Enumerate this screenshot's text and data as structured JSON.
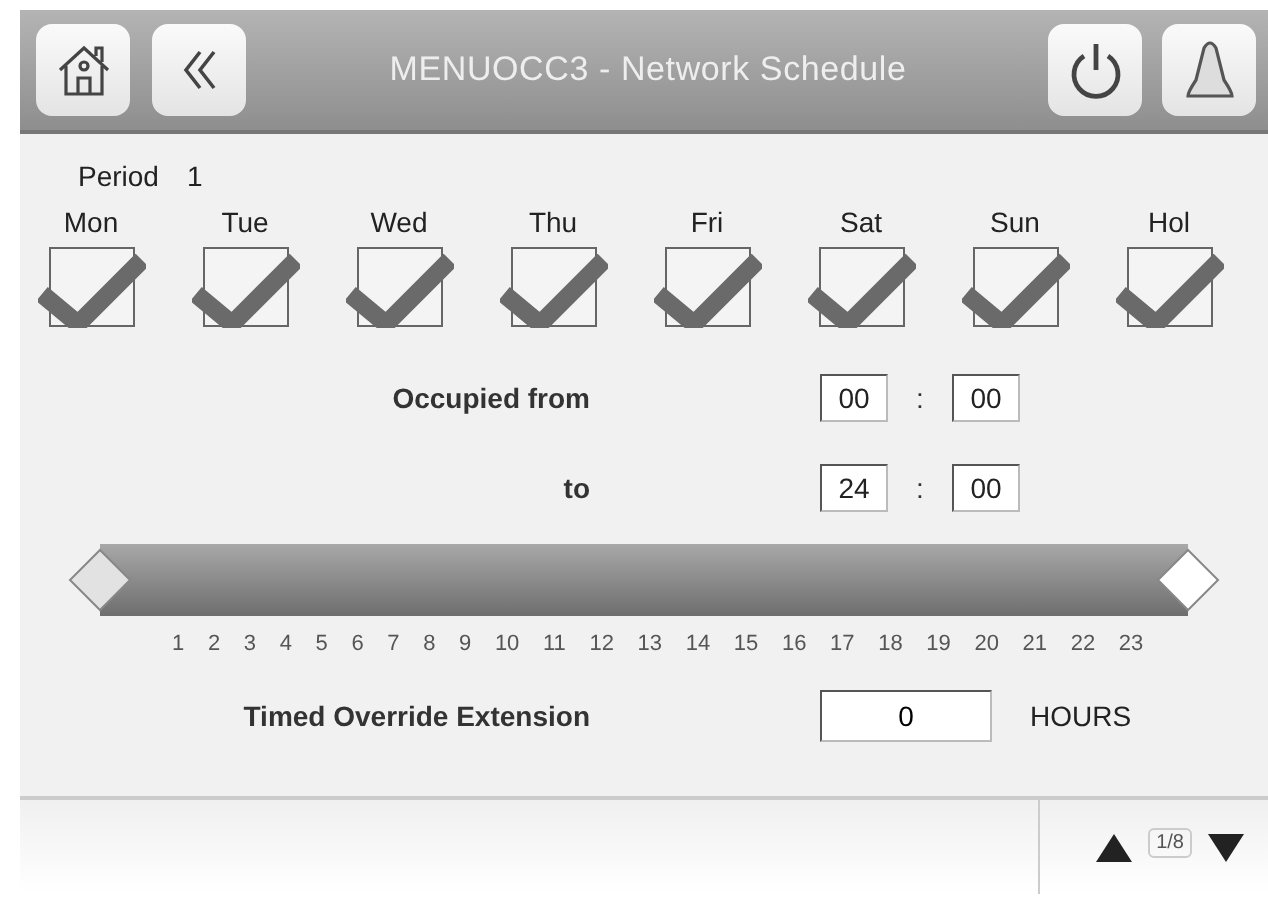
{
  "header": {
    "title": "MENUOCC3 - Network Schedule"
  },
  "period": {
    "label": "Period",
    "value": "1"
  },
  "days": [
    {
      "label": "Mon",
      "checked": true
    },
    {
      "label": "Tue",
      "checked": true
    },
    {
      "label": "Wed",
      "checked": true
    },
    {
      "label": "Thu",
      "checked": true
    },
    {
      "label": "Fri",
      "checked": true
    },
    {
      "label": "Sat",
      "checked": true
    },
    {
      "label": "Sun",
      "checked": true
    },
    {
      "label": "Hol",
      "checked": true
    }
  ],
  "times": [
    {
      "label": "Occupied from",
      "hours": "00",
      "separator": ":",
      "minutes": "00"
    },
    {
      "label": "to",
      "hours": "24",
      "separator": ":",
      "minutes": "00"
    }
  ],
  "range_slider": {
    "handles": [
      {
        "level": 0
      },
      {
        "level": 1
      }
    ],
    "ticks": [
      "1",
      "2",
      "3",
      "4",
      "5",
      "6",
      "7",
      "8",
      "9",
      "10",
      "11",
      "12",
      "13",
      "14",
      "15",
      "16",
      "17",
      "18",
      "19",
      "20",
      "21",
      "22",
      "23"
    ]
  },
  "override": {
    "label": "Timed Override Extension",
    "value": "0",
    "unit": "HOURS"
  },
  "footer": {
    "page": "1/8"
  }
}
